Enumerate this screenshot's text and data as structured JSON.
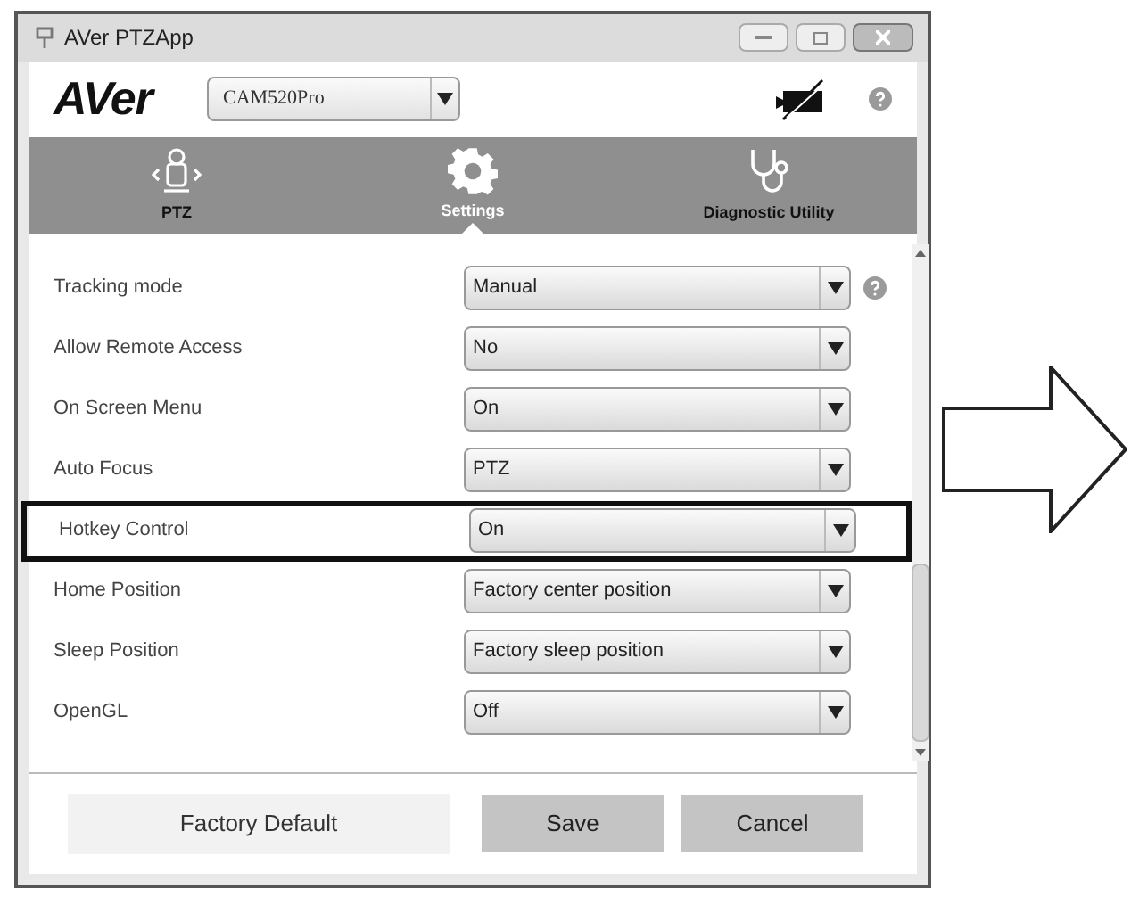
{
  "window": {
    "title": "AVer PTZApp"
  },
  "header": {
    "logo": "AVer",
    "camera_select": "CAM520Pro"
  },
  "tabs": [
    {
      "label": "PTZ",
      "selected": false
    },
    {
      "label": "Settings",
      "selected": true
    },
    {
      "label": "Diagnostic Utility",
      "selected": false
    }
  ],
  "settings": [
    {
      "label": "Tracking mode",
      "value": "Manual",
      "help": true,
      "highlighted": false
    },
    {
      "label": "Allow Remote Access",
      "value": "No",
      "help": false,
      "highlighted": false
    },
    {
      "label": "On Screen Menu",
      "value": "On",
      "help": false,
      "highlighted": false
    },
    {
      "label": "Auto Focus",
      "value": "PTZ",
      "help": false,
      "highlighted": false
    },
    {
      "label": "Hotkey Control",
      "value": "On",
      "help": false,
      "highlighted": true
    },
    {
      "label": "Home Position",
      "value": "Factory center position",
      "help": false,
      "highlighted": false
    },
    {
      "label": "Sleep Position",
      "value": "Factory sleep position",
      "help": false,
      "highlighted": false
    },
    {
      "label": "OpenGL",
      "value": "Off",
      "help": false,
      "highlighted": false
    }
  ],
  "buttons": [
    {
      "label": "Factory Default",
      "kind": "secondary"
    },
    {
      "label": "Save",
      "kind": "primary"
    },
    {
      "label": "Cancel",
      "kind": "primary"
    }
  ]
}
